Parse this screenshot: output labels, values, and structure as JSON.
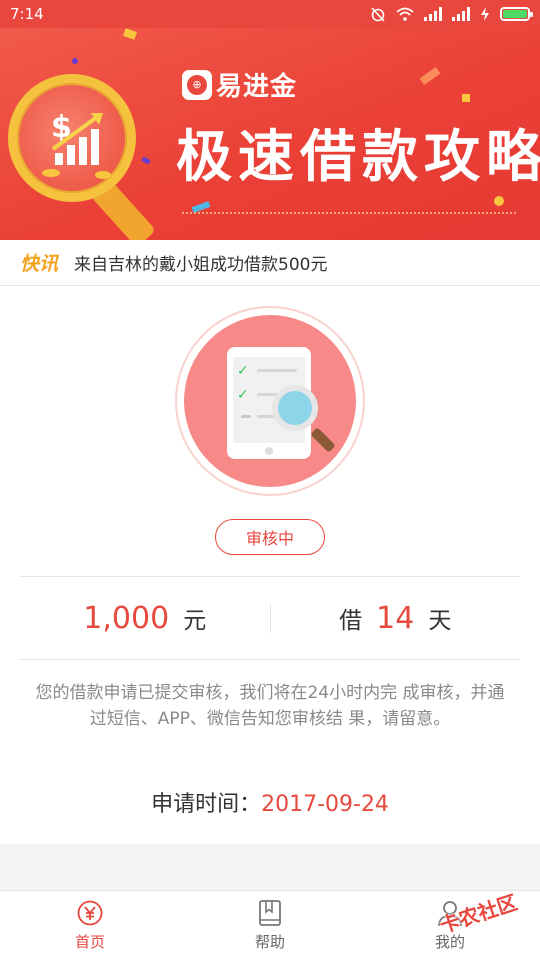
{
  "status_bar": {
    "time": "7:14"
  },
  "banner": {
    "logo_text": "易进金",
    "title": "极速借款攻略"
  },
  "news": {
    "tag": "快讯",
    "text": "来自吉林的戴小姐成功借款500元"
  },
  "application": {
    "status": "审核中",
    "amount": "1,000",
    "amount_unit": "元",
    "term_prefix": "借",
    "term_value": "14",
    "term_unit": "天",
    "description": "您的借款申请已提交审核，我们将在24小时内完 成审核，并通过短信、APP、微信告知您审核结 果，请留意。",
    "time_label": "申请时间：",
    "time_value": "2017-09-24"
  },
  "bottom_nav": {
    "items": [
      {
        "label": "首页",
        "icon": "yuan-coin-icon",
        "active": true
      },
      {
        "label": "帮助",
        "icon": "book-icon",
        "active": false
      },
      {
        "label": "我的",
        "icon": "person-icon",
        "active": false
      }
    ]
  },
  "watermark": "卡农社区",
  "colors": {
    "brand_red": "#e9463d",
    "amount_red": "#e64a3e",
    "news_tag": "#f5a21c",
    "check_green": "#3cc45a"
  }
}
